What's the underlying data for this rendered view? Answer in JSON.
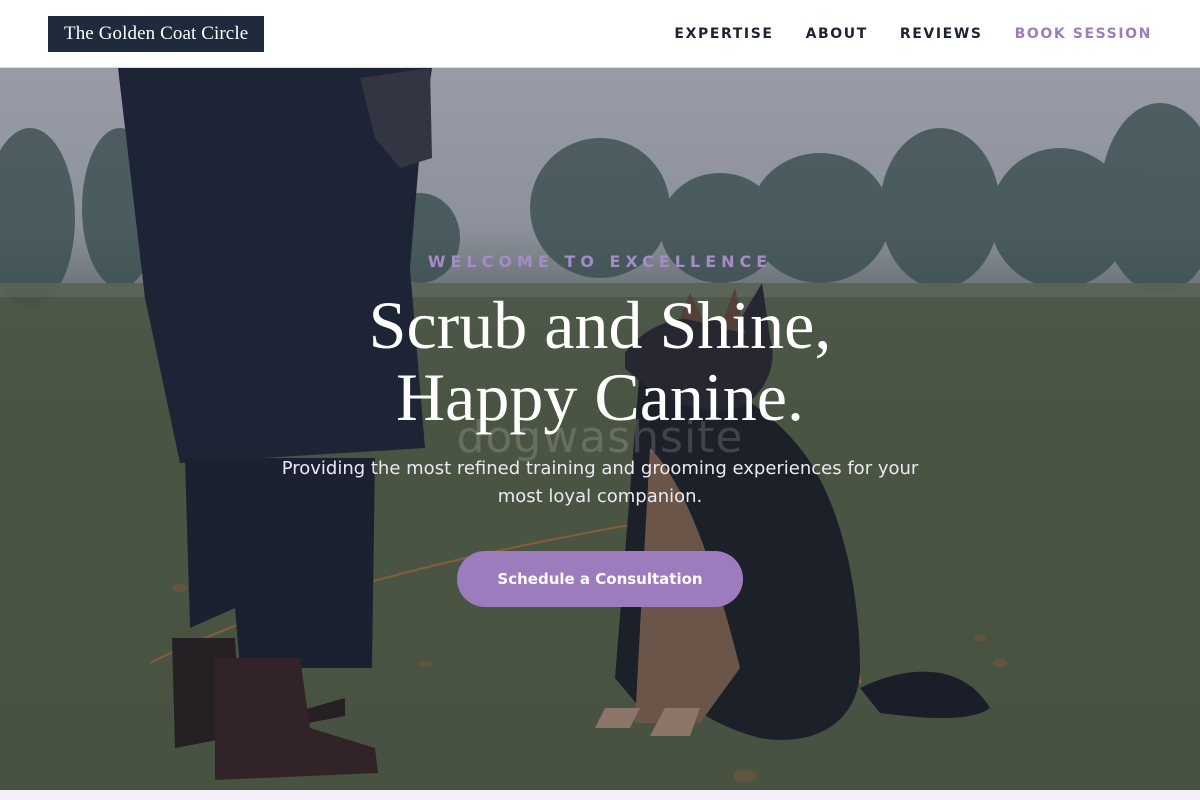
{
  "header": {
    "logo_text": "The Golden Coat Circle",
    "nav": [
      {
        "label": "EXPERTISE"
      },
      {
        "label": "ABOUT"
      },
      {
        "label": "REVIEWS"
      },
      {
        "label": "BOOK SESSION"
      }
    ]
  },
  "hero": {
    "eyebrow": "WELCOME TO EXCELLENCE",
    "headline_line1": "Scrub and Shine,",
    "headline_line2": "Happy Canine.",
    "watermark": "dogwashsite",
    "subtitle": "Providing the most refined training and grooming experiences for your most loyal companion.",
    "cta_label": "Schedule a Consultation",
    "image_subject": "person in long puffer coat standing with a German Shepherd on grass in a park"
  },
  "colors": {
    "accent": "#9c7cbd",
    "logo_bg": "#1f2a3c",
    "nav_text": "#1c2331",
    "nav_accent": "#9a7fb8"
  }
}
